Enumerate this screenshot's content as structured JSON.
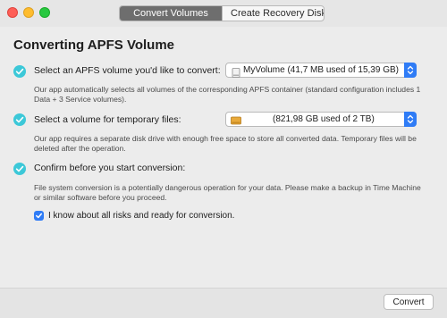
{
  "tabs": {
    "active_label": "Convert Volumes",
    "inactive_label": "Create Recovery Disk"
  },
  "main": {
    "title": "Converting APFS Volume",
    "steps": [
      {
        "label": "Select an APFS volume you'd like to convert:",
        "description": "Our app automatically selects all volumes of the corresponding APFS container (standard configuration includes 1 Data + 3 Service volumes).",
        "popup_value": "MyVolume (41,7 MB used of 15,39 GB)",
        "icon": "drive-icon"
      },
      {
        "label": "Select a volume for temporary files:",
        "description": "Our app requires a separate disk drive with enough free space to store all converted data. Temporary files will be deleted after the operation.",
        "popup_value": "(821,98 GB used of 2 TB)",
        "icon": "external-drive-icon"
      },
      {
        "label": "Confirm before you start conversion:",
        "description": "File system conversion is a potentially dangerous operation for your data. Please make a backup in Time Machine or similar software before you proceed."
      }
    ],
    "confirm_checkbox": {
      "label": "I know about all risks and ready for conversion.",
      "checked": true
    }
  },
  "footer": {
    "convert_label": "Convert"
  },
  "colors": {
    "step_check": "#3cc8d8",
    "accent": "#2f7cf6",
    "active_tab": "#6e6e6e"
  }
}
